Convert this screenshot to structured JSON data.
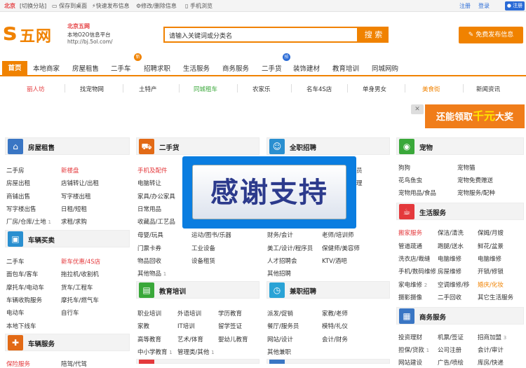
{
  "topbar": {
    "city": "北京",
    "switch_city": "[切换分站]",
    "save_desktop": "保存到桌面",
    "express_post": "快速发布信息",
    "edit_delete": "修改/删除信息",
    "mobile": "手机浏览",
    "register": "注册",
    "login": "登录",
    "register_btn": "注册"
  },
  "header": {
    "logo_s": "s",
    "logo_text": "五网",
    "site_name": "北京五网",
    "site_sub": "本地O2O信息平台",
    "site_url": "http://bj.5ol.com/",
    "search_placeholder": "请输入关键词或分类名",
    "search_btn": "搜 索",
    "post_btn": "免费发布信息"
  },
  "nav": {
    "home": "首页",
    "items": [
      "本地商家",
      "房屋租售",
      "二手车",
      "招聘求职",
      "生活服务",
      "商务服务",
      "二手货",
      "装饰建材",
      "教育培训",
      "同城网购"
    ],
    "badge_jie": "新",
    "badge_pin": "拍"
  },
  "subnav": [
    "丽人坊",
    "找宠物网",
    "土特产",
    "同城租车",
    "农家乐",
    "名车4S店",
    "单身男女",
    "美食街",
    "新闻资讯"
  ],
  "promo": {
    "prefix": "还能领取",
    "amount": "千元",
    "suffix": "大奖"
  },
  "categories": {
    "housing": {
      "title": "房屋租售",
      "links": [
        "二手房",
        "新楼盘",
        "房屋出租",
        "店铺转让/出租",
        "商铺出售",
        "写字楼出租",
        "写字楼出售",
        "日租/短租",
        "厂房/仓库/土地",
        "求租/求购"
      ],
      "count": "1"
    },
    "car_buy": {
      "title": "车辆买卖",
      "links": [
        "二手车",
        "新车优惠/4S店",
        "面包车/客车",
        "拖拉机/收割机",
        "摩托车/电动车",
        "货车/工程车",
        "车辆收购服务",
        "摩托车/燃气车",
        "电动车",
        "自行车",
        "本地下线车"
      ]
    },
    "car_service": {
      "title": "车辆服务",
      "links": [
        "保险服务",
        "陪驾/代驾"
      ]
    },
    "goods": {
      "title": "二手货",
      "links": [
        "手机及配件",
        "电脑转让",
        "家具/办公家具",
        "日常用品",
        "收藏品/工艺品",
        "母婴/玩具",
        "运动/图书/乐器",
        "门票卡券",
        "工业设备",
        "物品回收",
        "设备租赁",
        "其他物品"
      ],
      "count": "1"
    },
    "education": {
      "title": "教育培训",
      "links": [
        "职业培训",
        "外语培训",
        "学历教育",
        "家教",
        "IT培训",
        "留学签证",
        "高等教育",
        "艺术/体育",
        "婴幼儿教育",
        "中小学教育",
        "管理类/其他"
      ],
      "count1": "1",
      "count2": "1"
    },
    "jobs": {
      "title": "全职招聘",
      "links": [
        "财务/会计",
        "老师/培训师",
        "美工/设计/程序员",
        "保健师/美容师",
        "人才招聘会",
        "KTV/酒吧",
        "其他招聘"
      ],
      "hidden_tail": "员",
      "hidden_tail2": "理"
    },
    "parttime": {
      "title": "兼职招聘",
      "links": [
        "派发/促销",
        "家教/老师",
        "餐厅/服务员",
        "模特/礼仪",
        "网站/设计",
        "会计/财务",
        "其他兼职"
      ]
    },
    "pets": {
      "title": "宠物",
      "links": [
        "狗狗",
        "宠物猫",
        "花鸟鱼虫",
        "宠物免费赠送",
        "宠物用品/食品",
        "宠物服务/配种"
      ]
    },
    "life": {
      "title": "生活服务",
      "links": [
        "搬家服务",
        "保洁/清洗",
        "保姆/月嫂",
        "管道疏通",
        "跑腿/送水",
        "鲜花/盆景",
        "洗衣店/裁缝",
        "电脑维修",
        "电脑维修",
        "手机/数码维修",
        "房屋维修",
        "开锁/修锁",
        "家电维修",
        "空调维修/移",
        "婚庆/化妆",
        "摄影摄像",
        "二手回收",
        "其它生活服务"
      ],
      "count": "2"
    },
    "business": {
      "title": "商务服务",
      "links": [
        "投资理财",
        "机票/签证",
        "招商加盟",
        "担保/贷款",
        "公司注册",
        "会计/审计",
        "网站建设",
        "广告/喷绘",
        "库房/快递"
      ],
      "count1": "3",
      "count2": "1"
    }
  },
  "overlay": {
    "text": "感谢支持"
  },
  "colors": {
    "accent": "#f08200",
    "red": "#e4393c",
    "blue": "#2b6bd6"
  }
}
